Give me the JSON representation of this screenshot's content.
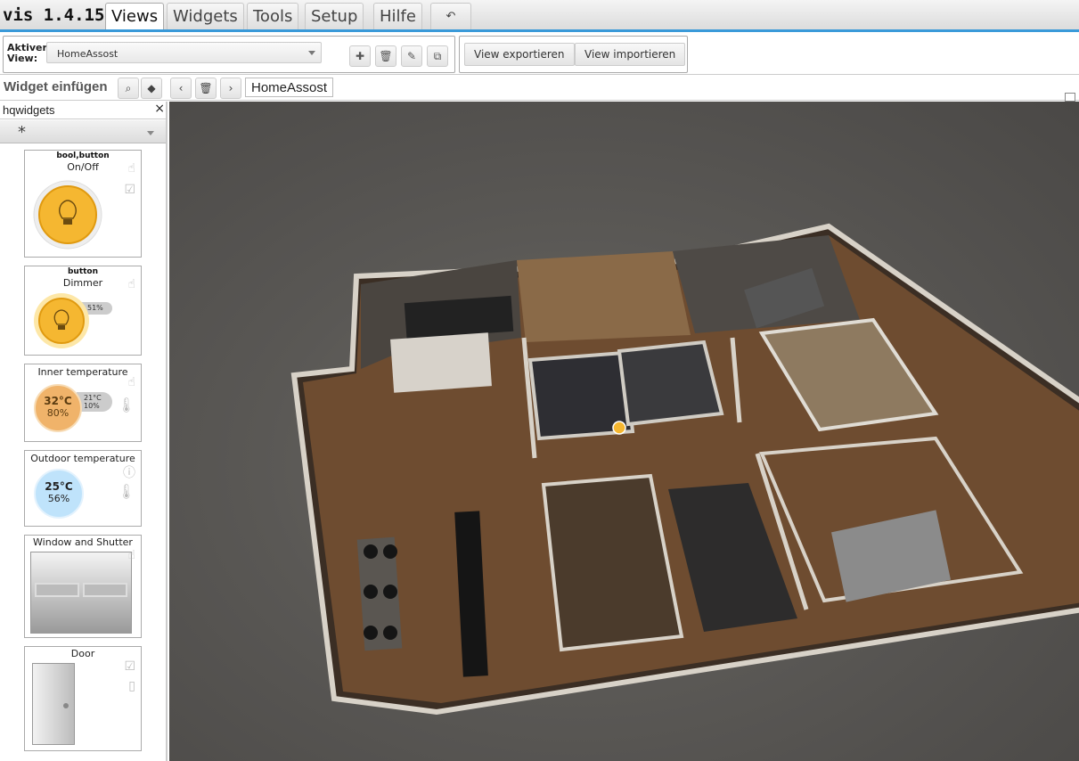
{
  "app": {
    "title": "vis 1.4.15"
  },
  "menu": {
    "tabs": [
      "Views",
      "Widgets",
      "Tools",
      "Setup",
      "Hilfe"
    ],
    "undo_icon": "undo-icon",
    "active_tab": "Views"
  },
  "view_bar": {
    "label": "Aktiver View:",
    "selected_view": "HomeAssost",
    "buttons": [
      "add-icon",
      "trash-icon",
      "edit-icon",
      "copy-icon"
    ],
    "export_label": "View exportieren",
    "import_label": "View importieren"
  },
  "widget_bar": {
    "title": "Widget einfügen",
    "search_icon": "search-icon",
    "tag_icon": "tag-icon",
    "filter_value": "hqwidgets",
    "set_value": "*"
  },
  "nav": {
    "prev_icon": "chevron-left-icon",
    "delete_icon": "trash-icon",
    "next_icon": "chevron-right-icon",
    "view_name": "HomeAssost"
  },
  "widgets": [
    {
      "subtitle": "bool,button",
      "title": "On/Off"
    },
    {
      "subtitle": "button",
      "title": "Dimmer",
      "percent": "51%"
    },
    {
      "subtitle": "",
      "title": "Inner temperature",
      "temp": "32°C",
      "humidity": "80%",
      "set_temp": "21°C",
      "set_hum": "10%"
    },
    {
      "subtitle": "",
      "title": "Outdoor temperature",
      "temp": "25°C",
      "humidity": "56%"
    },
    {
      "subtitle": "",
      "title": "Window and Shutter"
    },
    {
      "subtitle": "",
      "title": "Door"
    }
  ],
  "colors": {
    "accent": "#3a9ad9",
    "bulb": "#f5b731",
    "inner_temp": "#f0b36a",
    "outdoor_temp": "#bfe3fb"
  }
}
